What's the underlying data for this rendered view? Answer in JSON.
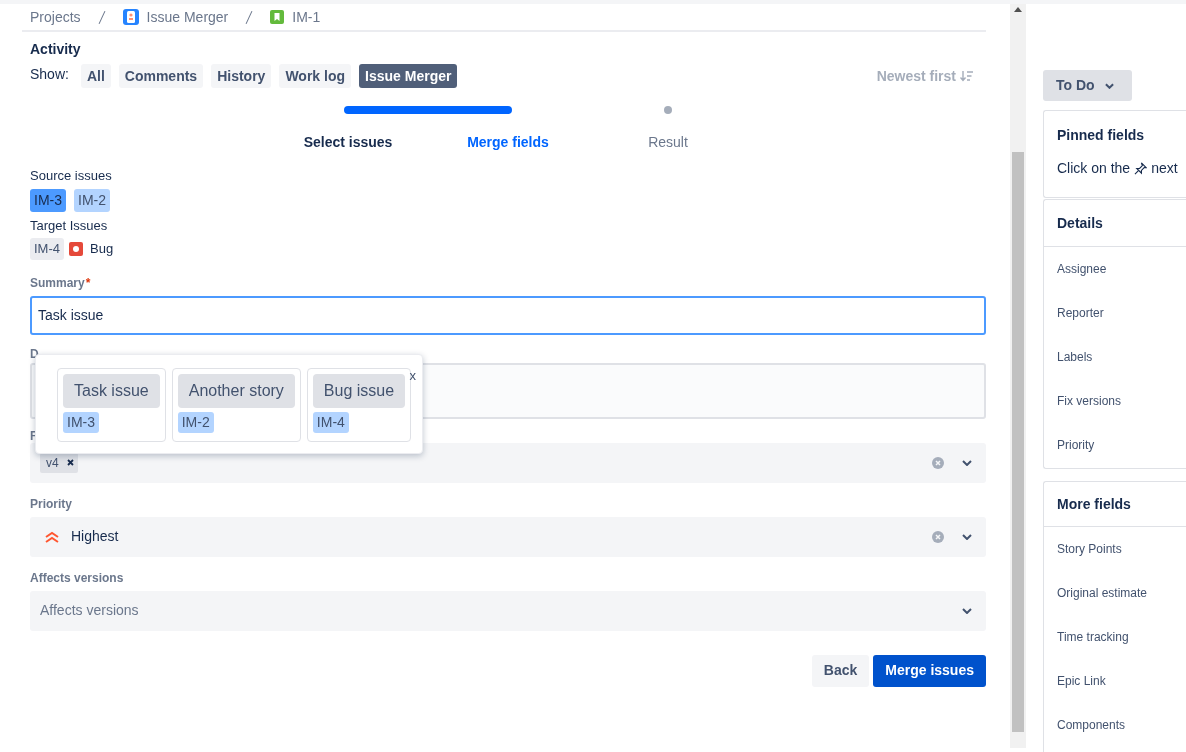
{
  "breadcrumbs": [
    {
      "label": "Projects",
      "kind": "text"
    },
    {
      "label": "Issue Merger",
      "kind": "project"
    },
    {
      "label": "IM-1",
      "kind": "story"
    }
  ],
  "activity": {
    "title": "Activity",
    "show_label": "Show:",
    "filters": [
      {
        "label": "All",
        "selected": false
      },
      {
        "label": "Comments",
        "selected": false
      },
      {
        "label": "History",
        "selected": false
      },
      {
        "label": "Work log",
        "selected": false
      },
      {
        "label": "Issue Merger",
        "selected": true
      }
    ],
    "sort": "Newest first"
  },
  "stepper": {
    "steps": [
      {
        "label": "Select issues",
        "done": true,
        "selected": false
      },
      {
        "label": "Merge fields",
        "done": false,
        "selected": true
      },
      {
        "label": "Result",
        "done": false,
        "selected": false
      }
    ]
  },
  "source": {
    "label": "Source issues",
    "issues": [
      {
        "key": "IM-3",
        "selected": true
      },
      {
        "key": "IM-2",
        "selected": false
      }
    ]
  },
  "target": {
    "label": "Target Issues",
    "key": "IM-4",
    "type": "Bug"
  },
  "summary": {
    "label": "Summary",
    "required_mark": "*",
    "value": "Task issue"
  },
  "description": {
    "label": "D"
  },
  "fix_versions": {
    "label": "F",
    "tags": [
      "v4"
    ]
  },
  "priority": {
    "label": "Priority",
    "value": "Highest"
  },
  "affects_versions": {
    "label": "Affects versions",
    "placeholder": "Affects versions"
  },
  "popup": {
    "close": "x",
    "options": [
      {
        "text": "Task issue",
        "key": "IM-3"
      },
      {
        "text": "Another story",
        "key": "IM-2"
      },
      {
        "text": "Bug issue",
        "key": "IM-4"
      }
    ]
  },
  "buttons": [
    {
      "label": "Back",
      "kind": "secondary"
    },
    {
      "label": "Merge issues",
      "kind": "primary"
    }
  ],
  "sidebar": {
    "status": "To Do",
    "pinned": {
      "title": "Pinned fields",
      "text_before": "Click on the",
      "text_after": "next"
    },
    "details": {
      "title": "Details",
      "fields": [
        "Assignee",
        "Reporter",
        "Labels",
        "Fix versions",
        "Priority"
      ]
    },
    "more": {
      "title": "More fields",
      "fields": [
        "Story Points",
        "Original estimate",
        "Time tracking",
        "Epic Link",
        "Components"
      ]
    }
  }
}
